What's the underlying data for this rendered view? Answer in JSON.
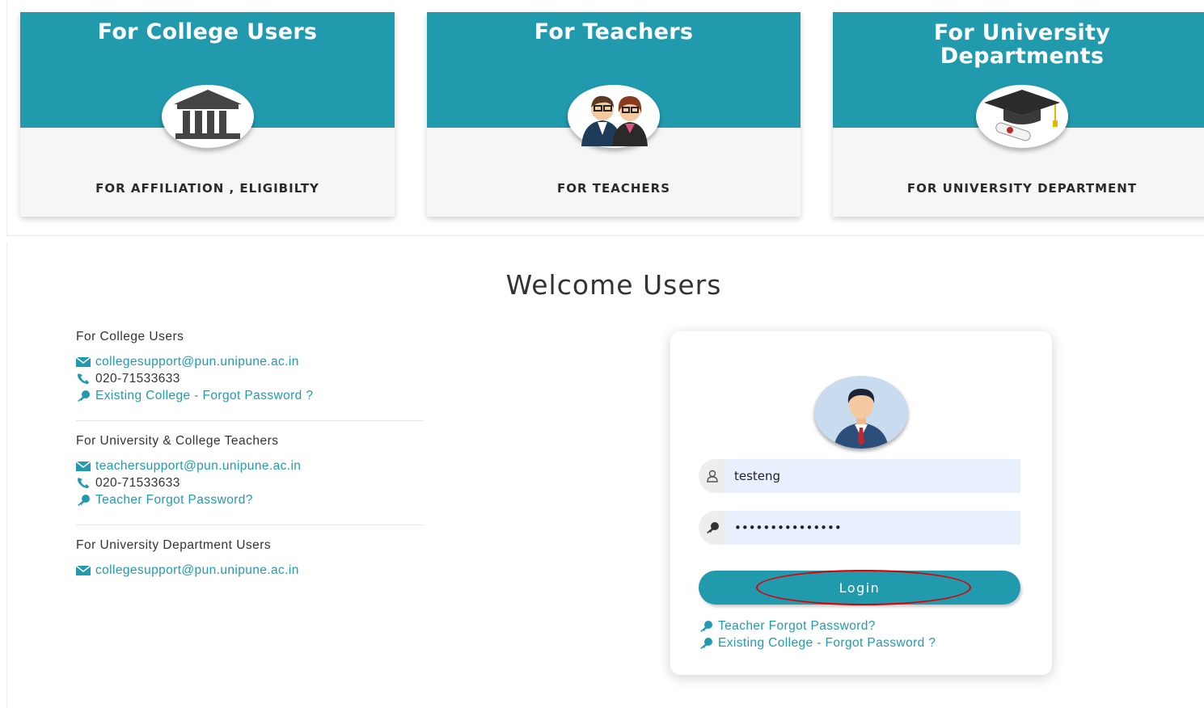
{
  "cards": [
    {
      "title": "For College Users",
      "subtitle": "FOR AFFILIATION , ELIGIBILTY",
      "icon": "building-icon"
    },
    {
      "title": "For Teachers",
      "subtitle": "FOR TEACHERS",
      "icon": "teachers-icon"
    },
    {
      "title": "For University\nDepartments",
      "subtitle": "FOR UNIVERSITY DEPARTMENT",
      "icon": "graduation-cap-icon"
    }
  ],
  "welcome": "Welcome Users",
  "contacts": {
    "college": {
      "title": "For College Users",
      "email": "collegesupport@pun.unipune.ac.in",
      "phone": "020-71533633",
      "forgot": "Existing College - Forgot Password ?"
    },
    "teachers": {
      "title": "For University & College Teachers",
      "email": "teachersupport@pun.unipune.ac.in",
      "phone": "020-71533633",
      "forgot": "Teacher Forgot Password?"
    },
    "department": {
      "title": "For University Department Users",
      "email": "collegesupport@pun.unipune.ac.in"
    }
  },
  "login": {
    "username": "testeng",
    "password": "•••••••••••••••",
    "button": "Login",
    "teacher_forgot": "Teacher Forgot Password?",
    "college_forgot": "Existing College - Forgot Password ?"
  },
  "colors": {
    "accent": "#219aae",
    "highlight": "#dd0000"
  }
}
